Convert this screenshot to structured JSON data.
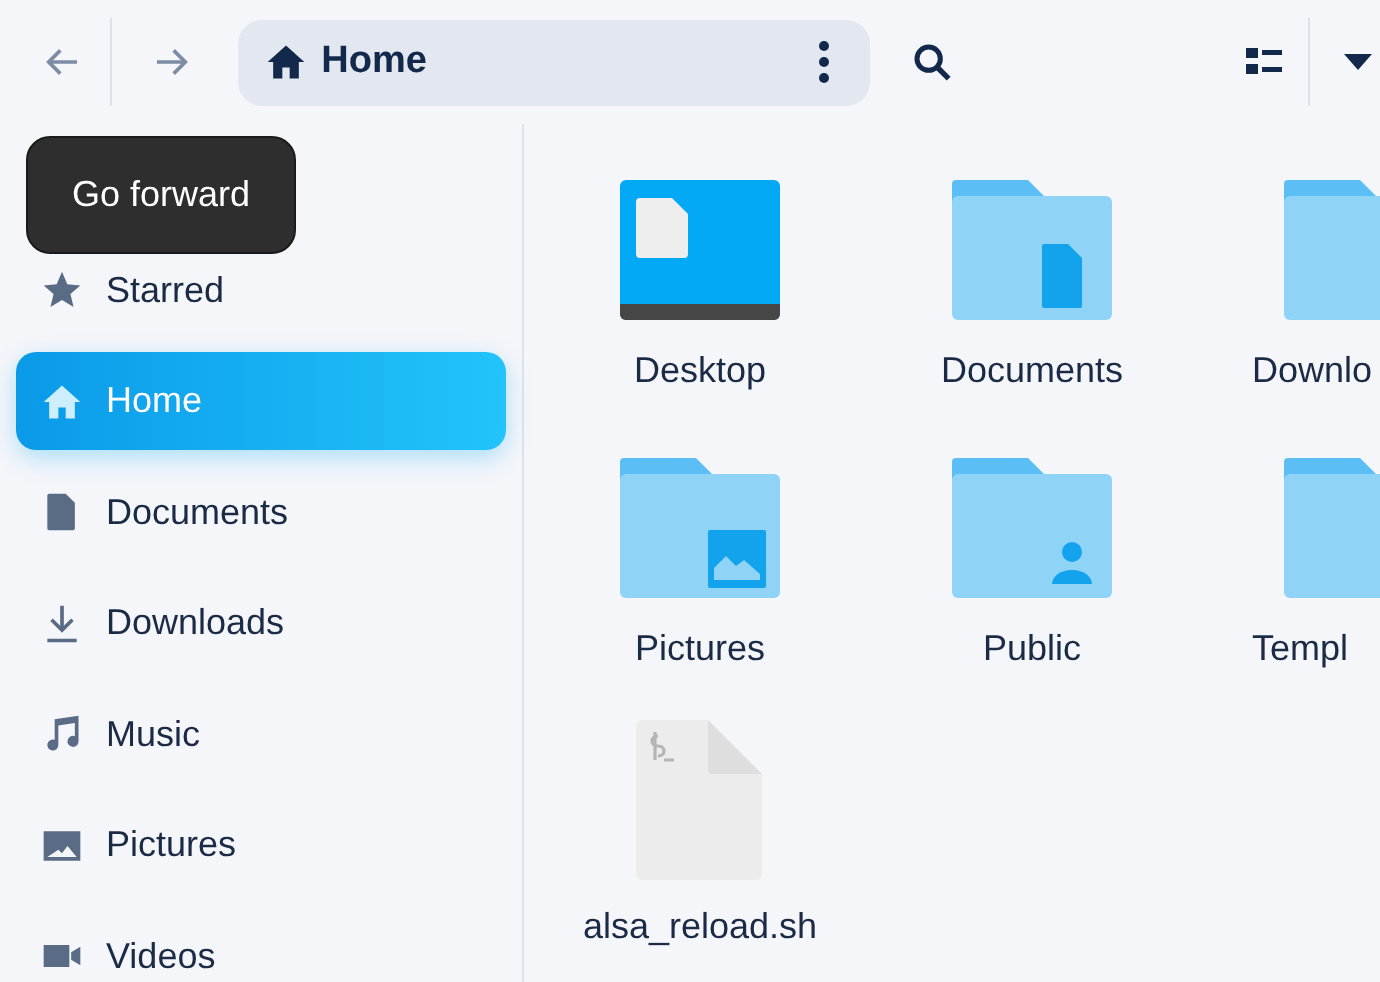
{
  "toolbar": {
    "path": "Home"
  },
  "tooltip": {
    "text": "Go forward"
  },
  "sidebar": {
    "items": [
      {
        "kind": "starred",
        "label": "Starred",
        "selected": false
      },
      {
        "kind": "home",
        "label": "Home",
        "selected": true
      },
      {
        "kind": "documents",
        "label": "Documents",
        "selected": false
      },
      {
        "kind": "downloads",
        "label": "Downloads",
        "selected": false
      },
      {
        "kind": "music",
        "label": "Music",
        "selected": false
      },
      {
        "kind": "pictures",
        "label": "Pictures",
        "selected": false
      },
      {
        "kind": "videos",
        "label": "Videos",
        "selected": false
      }
    ]
  },
  "files": [
    {
      "kind": "desktop",
      "name": "Desktop"
    },
    {
      "kind": "documents-folder",
      "name": "Documents"
    },
    {
      "kind": "downloads-folder",
      "name": "Downlo"
    },
    {
      "kind": "pictures-folder",
      "name": "Pictures"
    },
    {
      "kind": "public-folder",
      "name": "Public"
    },
    {
      "kind": "templates-folder",
      "name": "Templ"
    },
    {
      "kind": "script-file",
      "name": "alsa_reload.sh"
    }
  ]
}
